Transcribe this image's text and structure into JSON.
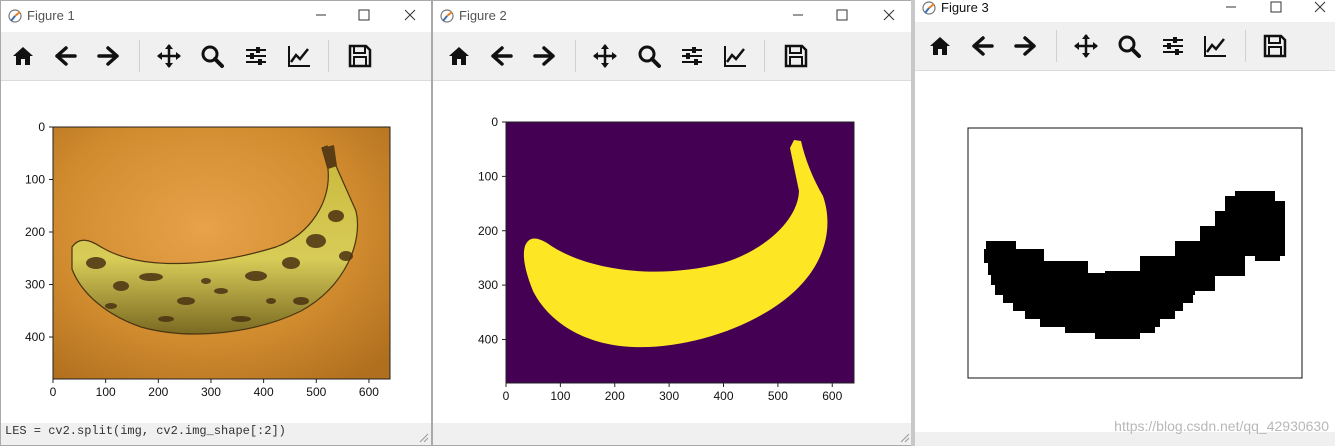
{
  "windows": [
    {
      "title": "Figure 1"
    },
    {
      "title": "Figure 2"
    },
    {
      "title": "Figure 3"
    }
  ],
  "toolbar_icons": [
    "home-icon",
    "back-arrow-icon",
    "forward-arrow-icon",
    "pan-icon",
    "zoom-icon",
    "configure-subplots-icon",
    "edit-axes-icon",
    "save-icon"
  ],
  "figure1": {
    "xticks": [
      "0",
      "100",
      "200",
      "300",
      "400",
      "500",
      "600"
    ],
    "yticks": [
      "0",
      "100",
      "200",
      "300",
      "400"
    ],
    "status_text": "LES = cv2.split(img, cv2.img_shape[:2])"
  },
  "figure2": {
    "xticks": [
      "0",
      "100",
      "200",
      "300",
      "400",
      "500",
      "600"
    ],
    "yticks": [
      "0",
      "100",
      "200",
      "300",
      "400"
    ],
    "colors": {
      "background": "#440154",
      "mask": "#fde725"
    }
  },
  "watermark": "https://blog.csdn.net/qq_42930630"
}
